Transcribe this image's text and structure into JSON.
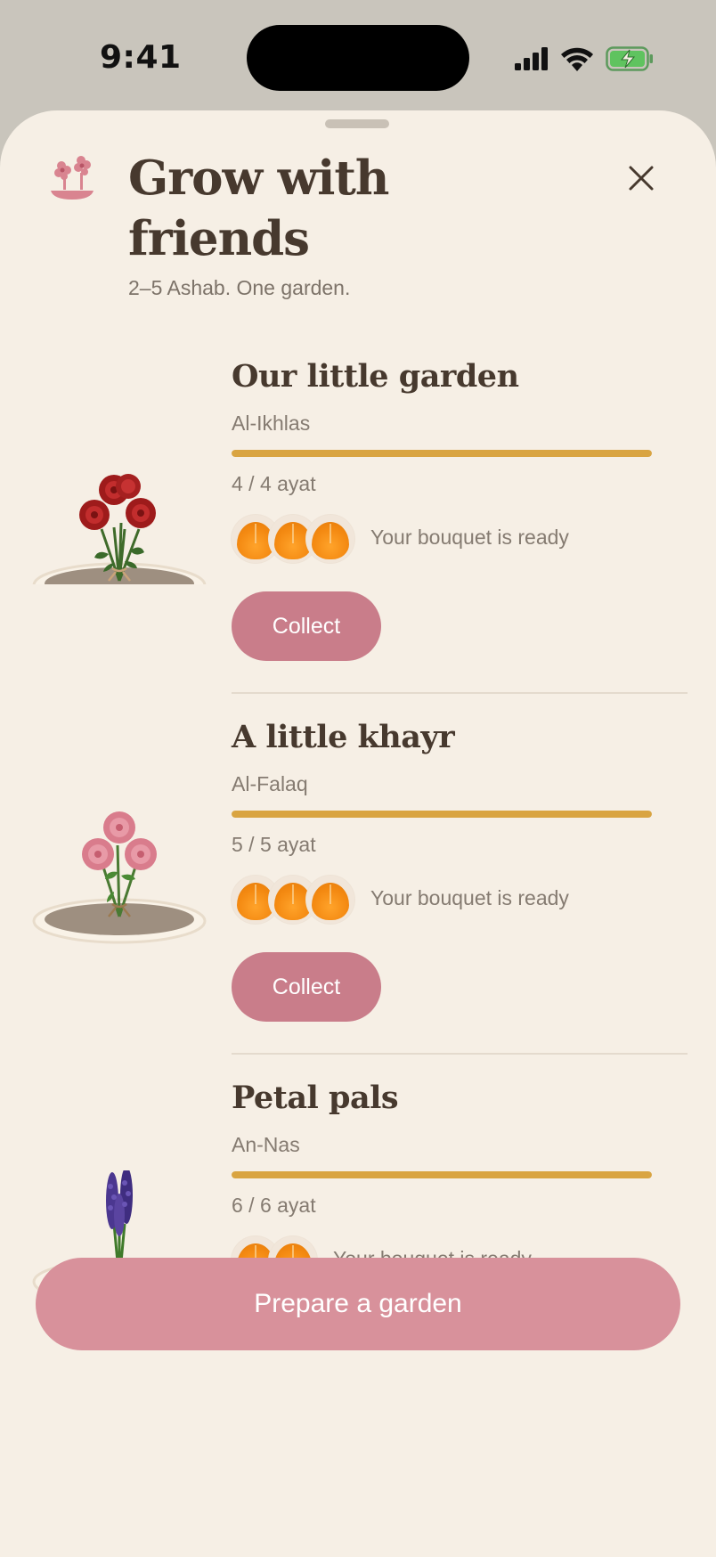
{
  "status_bar": {
    "time": "9:41",
    "battery": "charging",
    "signal_bars": 4
  },
  "header": {
    "title": "Grow with friends",
    "subtitle": "2–5 Ashab. One garden.",
    "icon": "flower-pot-icon",
    "close_icon": "close-icon"
  },
  "gardens": [
    {
      "name": "Our little garden",
      "surah": "Al-Ikhlas",
      "progress": 1.0,
      "progress_text": "4 / 4 ayat",
      "member_count": 3,
      "status": "Your bouquet is ready",
      "button_label": "Collect",
      "flower": "red-rose-bouquet"
    },
    {
      "name": "A little khayr",
      "surah": "Al-Falaq",
      "progress": 1.0,
      "progress_text": "5 / 5 ayat",
      "member_count": 3,
      "status": "Your bouquet is ready",
      "button_label": "Collect",
      "flower": "pink-rose-bouquet"
    },
    {
      "name": "Petal pals",
      "surah": "An-Nas",
      "progress": 1.0,
      "progress_text": "6 / 6 ayat",
      "member_count": 2,
      "status": "Your bouquet is ready",
      "button_label": "",
      "flower": "lavender-bouquet"
    }
  ],
  "footer": {
    "primary_label": "Prepare a garden"
  },
  "colors": {
    "background": "#f6efe5",
    "title": "#47392e",
    "progress": "#d9a441",
    "collect_button": "#c97d8a",
    "primary_button": "#d8919b",
    "avatar": "#f48a12"
  }
}
